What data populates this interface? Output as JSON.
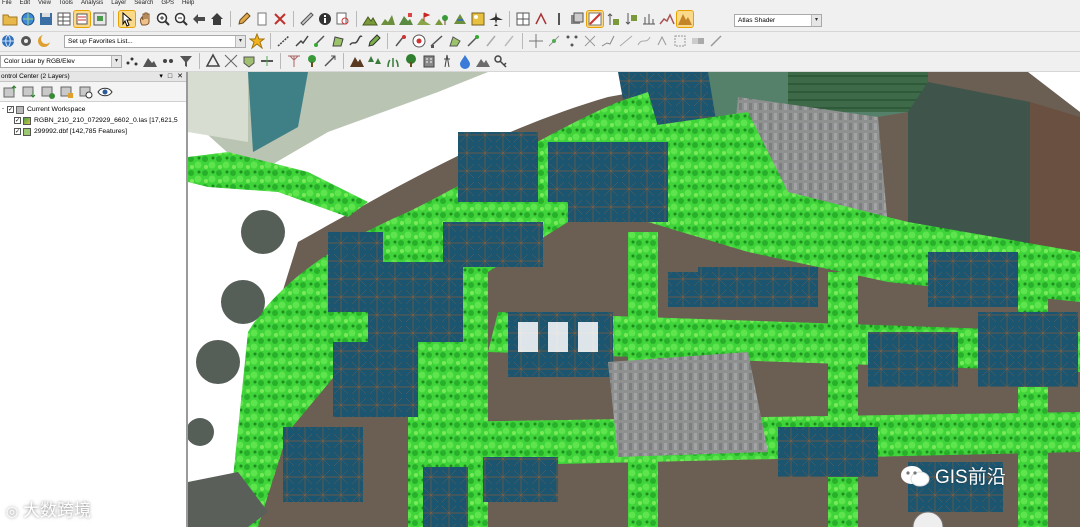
{
  "menu": [
    "File",
    "Edit",
    "View",
    "Tools",
    "Analysis",
    "Layer",
    "Search",
    "GPS",
    "Help"
  ],
  "toolbar": {
    "favorites_placeholder": "Set up Favorites List...",
    "shader_select": "Atlas Shader",
    "lidar_color_select": "Color Lidar by RGB/Elev"
  },
  "control_center": {
    "title": "ontrol Center (2 Layers)",
    "workspace_label": "Current Workspace",
    "layers": [
      {
        "name": "RGBN_210_210_072929_6602_0.las [17,621,5"
      },
      {
        "name": "299992.dbf [142,785 Features]"
      }
    ]
  },
  "watermarks": {
    "left": "大数跨境",
    "right": "GIS前沿"
  },
  "colors": {
    "vegetation_green": "#3fd43a",
    "roof_blue": "#1c5570",
    "panel_border": "#9a9a9a"
  }
}
